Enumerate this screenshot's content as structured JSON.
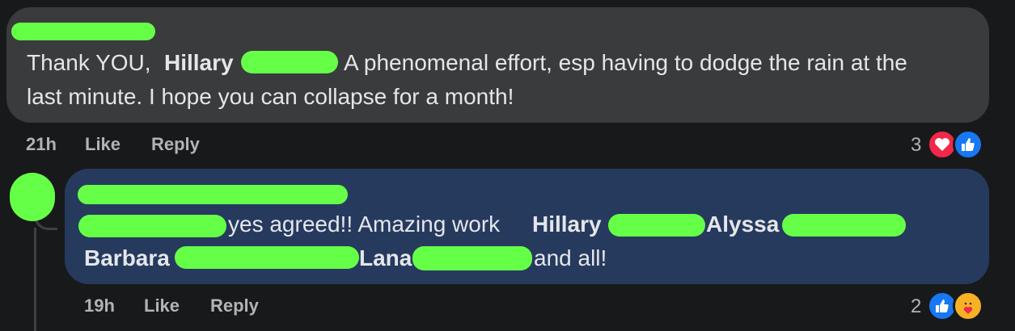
{
  "comment1": {
    "text_part1": "Thank YOU, ",
    "mention": "Hillary",
    "text_part2": "A phenomenal effort, esp having to dodge the rain at the",
    "text_line2": "last minute. I hope you can collapse for a month!",
    "time": "21h",
    "like_label": "Like",
    "reply_label": "Reply",
    "reaction_count": "3",
    "reactions": [
      "heart-icon",
      "like-icon"
    ]
  },
  "comment2": {
    "text_part1": "yes agreed!! Amazing work ",
    "mention1": "Hillary",
    "mention2": "Alyssa",
    "mention3": "Barbara",
    "mention4": "Lana",
    "text_end": "and all!",
    "time": "19h",
    "like_label": "Like",
    "reply_label": "Reply",
    "reaction_count": "2",
    "reactions": [
      "like-icon",
      "care-icon"
    ]
  },
  "colors": {
    "background": "#18191a",
    "bubble": "#3a3b3c",
    "reply_bubble": "#263a5e",
    "redaction": "#66ff47"
  }
}
